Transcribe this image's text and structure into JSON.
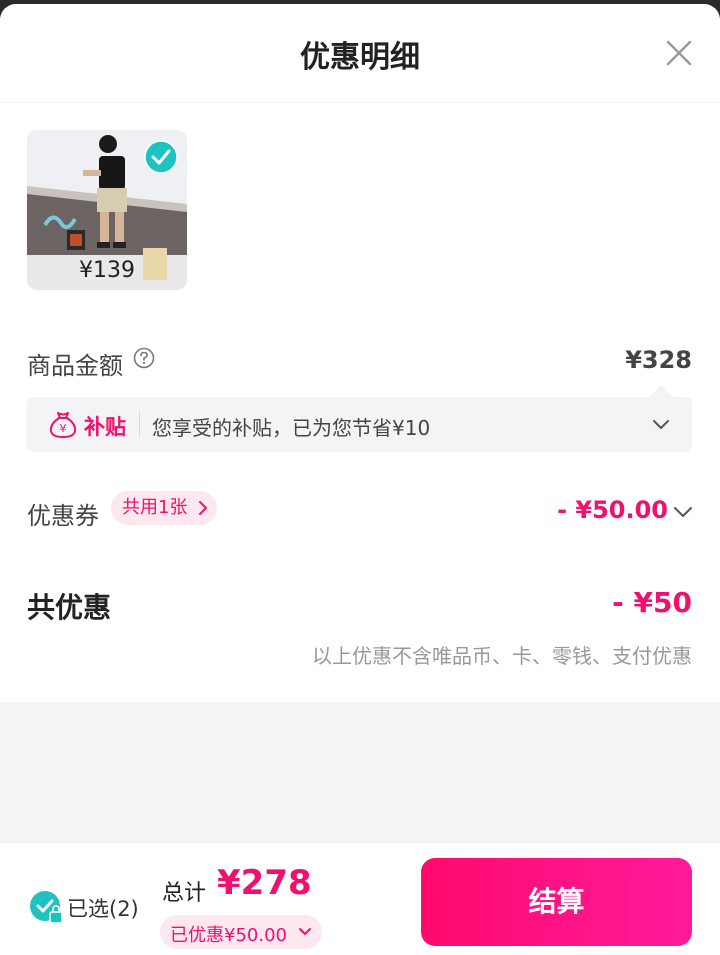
{
  "header": {
    "title": "优惠明细"
  },
  "product": {
    "price": "¥139",
    "selected": true
  },
  "amount": {
    "label": "商品金额",
    "value": "¥328"
  },
  "subsidy": {
    "tag": "补贴",
    "text": "您享受的补贴，已为您节省¥10",
    "icon_text": "¥"
  },
  "coupon": {
    "label": "优惠券",
    "pill": "共用1张",
    "value": "- ¥50.00"
  },
  "total_discount": {
    "label": "共优惠",
    "value": "- ¥50",
    "note": "以上优惠不含唯品币、卡、零钱、支付优惠"
  },
  "footer": {
    "selected_text": "已选(2)",
    "total_label": "总计",
    "total_value": "¥278",
    "saved_text": "已优惠¥50.00",
    "checkout_label": "结算"
  },
  "colors": {
    "accent": "#f0106e",
    "check": "#1ec2c0"
  }
}
